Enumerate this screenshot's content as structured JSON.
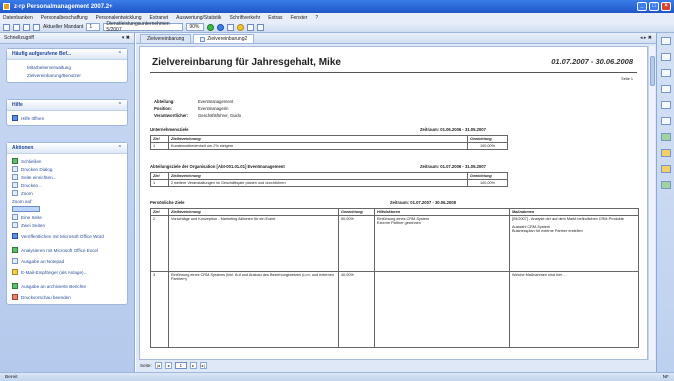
{
  "window": {
    "title": "z-rp Personalmanagement 2007.2+"
  },
  "menu": [
    "Datenbanken",
    "Personalbeschaffung",
    "Personalentwicklung",
    "Extranet",
    "Auswertung/Statistik",
    "Schriftverkehr",
    "Extras",
    "Fenster",
    "?"
  ],
  "toolbar": {
    "view_label": "Aktueller Mandant",
    "mandant_value": "1",
    "company_select": "Dienstleistungsunternehmen 5/2007",
    "zoom_select": "90%"
  },
  "sidebar": {
    "header_label": "Schnellzugriff",
    "header_ctrl": "▾ ✖",
    "panel1": {
      "title": "Häufig aufgerufene Bef...",
      "items": [
        "Mitarbeiterverwaltung",
        "Zielvereinbarung/Benutzer"
      ]
    },
    "panel2": {
      "title": "Hilfe",
      "items": [
        "Hilfe öffnen"
      ]
    },
    "panel3": {
      "title": "Aktionen",
      "items": [
        "Schließen",
        "Drucken Dialog",
        "Seite einrichten...",
        "Drucken...",
        "Zoom",
        "Zoom auf:",
        "Eine Seite",
        "Zwei Seiten",
        "Veröffentlichen mit Microsoft Office Word",
        "Analysieren mit Microsoft Office Excel",
        "Ausgabe an Notepad",
        "E-Mail-Empfänger (als Anlage)...",
        "Ausgabe an archivierte Berichte",
        "Druckvorschau beenden"
      ]
    }
  },
  "tabs": [
    "Zielvereinbarung",
    "Zielvereinbarung2"
  ],
  "tab_controls": "◂ ▸ ✖",
  "report": {
    "title": "Zielvereinbarung für Jahresgehalt, Mike",
    "date_range": "01.07.2007 - 30.06.2008",
    "page_label": "Seite 1",
    "meta": [
      {
        "label": "Abteilung:",
        "value": "Eventmanagement"
      },
      {
        "label": "Position:",
        "value": "Eventmanagerin"
      },
      {
        "label": "Verantwortlicher:",
        "value": "Geschäftsführer, Guido"
      }
    ],
    "sections": [
      {
        "title": "Unternehmensziele",
        "period_label": "Zeitraum:",
        "period": "01.06.2006 - 31.05.2007",
        "headers": [
          "Ziel",
          "Zielbezeichnung",
          "Gewichtung"
        ],
        "rows": [
          [
            "1",
            "Kundenzufriedenheit um 2% steigern",
            "100,00%"
          ]
        ]
      },
      {
        "title": "Abteilungsziele der Organisation [Abt-001.01.01] Eventmanagement",
        "period_label": "Zeitraum:",
        "period": "01.07.2006 - 31.05.2007",
        "headers": [
          "Ziel",
          "Zielbezeichnung",
          "Gewichtung"
        ],
        "rows": [
          [
            "1",
            "2 weitere Veranstaltungen im Geschäftsjahr planen und durchführen",
            "100,00%"
          ]
        ]
      },
      {
        "title": "Persönliche Ziele",
        "period_label": "Zeitraum:",
        "period": "01.07.2007 - 30.06.2008",
        "headers": [
          "Ziel",
          "Zielbezeichnung",
          "Gewichtung",
          "Hilfsfaktoren",
          "Maßnahmen"
        ],
        "rows": [
          [
            "2",
            "Vorschläge und Konzeption - Marketing Aktionen für ein Event",
            "50,00%",
            "Einführung eines CRM-System\nExterne Partner gewinnen",
            "[09/2007] - Analyse der auf dem Markt befindlichen CRM-Produkte\n\nAuswahl CRM-System\nBusinessplan für externe Partner erstellen"
          ],
          [
            "3",
            "Einführung eines CRM-Systems (inkl. Auf und Ausbau des Beziehungsnetzes (u.m. und externen Partnern)",
            "40,00%",
            "",
            "Welche Maßnahmen sind hier ..."
          ]
        ]
      }
    ]
  },
  "pager": {
    "label": "Seite:",
    "page": "1"
  },
  "status": {
    "left": "Bereit",
    "right": "NF"
  },
  "colors": {
    "titlebar": "#2b65d9",
    "accent": "#24479a"
  }
}
